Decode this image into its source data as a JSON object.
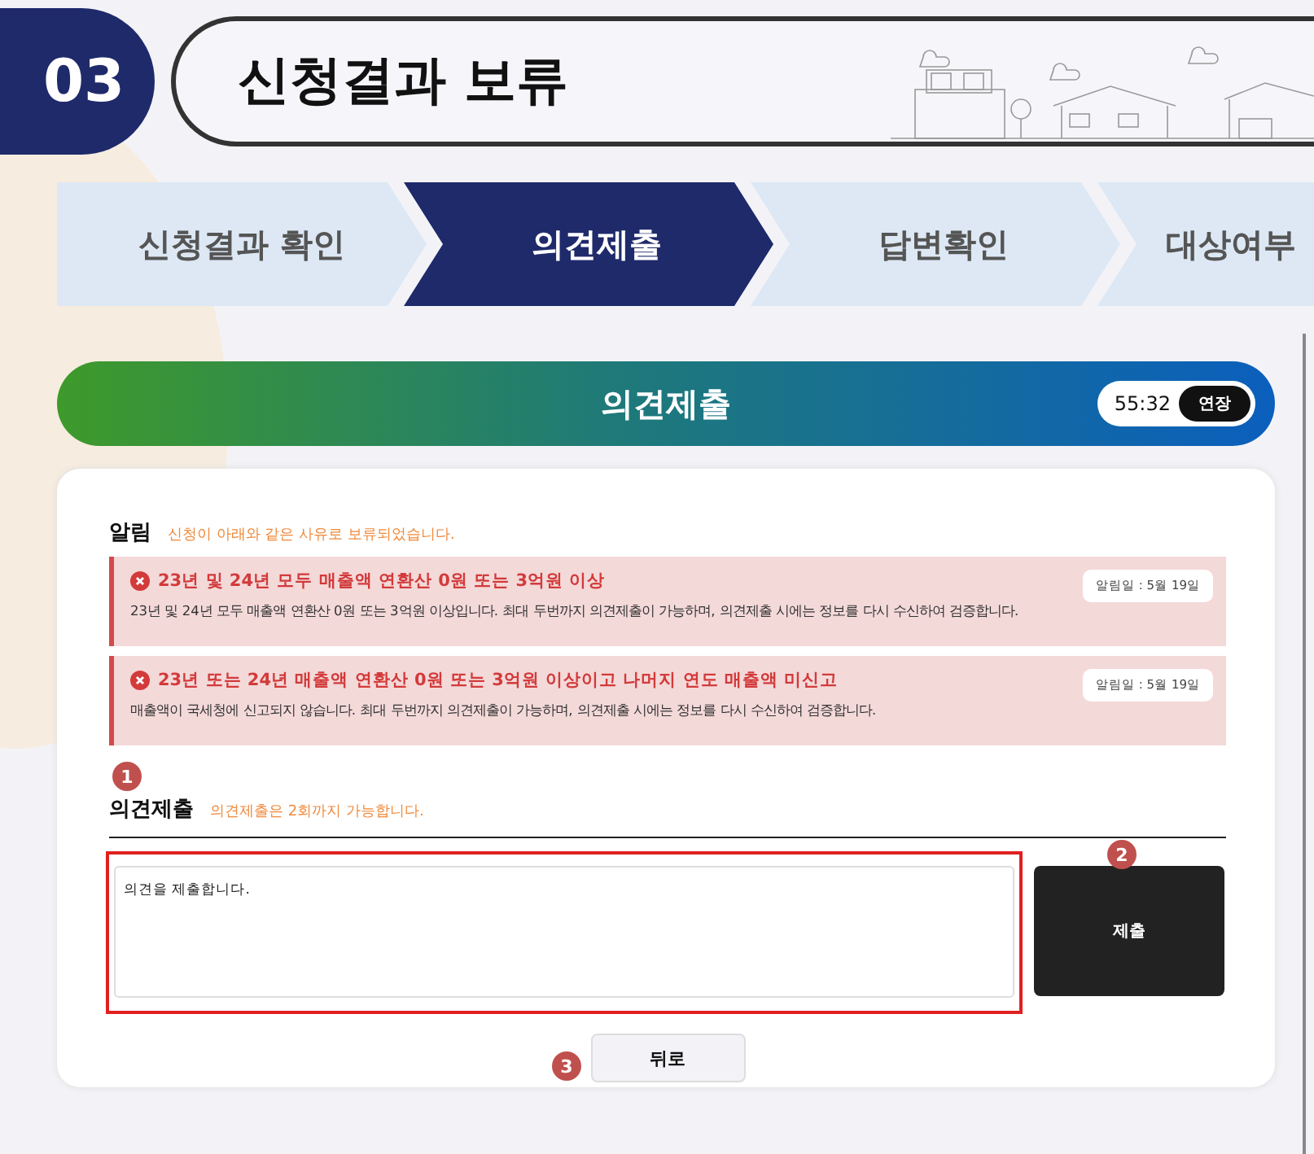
{
  "header": {
    "number": "03",
    "title": "신청결과 보류"
  },
  "steps": [
    {
      "label": "신청결과 확인",
      "selected": false
    },
    {
      "label": "의견제출",
      "selected": true
    },
    {
      "label": "답변확인",
      "selected": false
    },
    {
      "label": "대상여부",
      "selected": false
    }
  ],
  "section_bar": {
    "title": "의견제출",
    "timer": "55:32",
    "extend_button": "연장"
  },
  "notice": {
    "title": "알림",
    "subtitle": "신청이 아래와 같은 사유로 보류되었습니다.",
    "alerts": [
      {
        "title": "23년 및 24년 모두 매출액 연환산 0원 또는 3억원 이상",
        "body": "23년 및 24년 모두 매출액 연환산 0원 또는 3억원 이상입니다. 최대 두번까지 의견제출이 가능하며, 의견제출 시에는 정보를 다시 수신하여 검증합니다.",
        "date": "알림일 : 5월 19일"
      },
      {
        "title": "23년 또는 24년 매출액 연환산 0원 또는 3억원 이상이고 나머지 연도 매출액 미신고",
        "body": "매출액이 국세청에 신고되지 않습니다. 최대 두번까지 의견제출이 가능하며, 의견제출 시에는 정보를 다시 수신하여 검증합니다.",
        "date": "알림일 : 5월 19일"
      }
    ]
  },
  "opinion": {
    "marker": "1",
    "title": "의견제출",
    "hint": "의견제출은 2회까지 가능합니다.",
    "value": "의견을 제출합니다.",
    "submit_marker": "2",
    "submit_button": "제출",
    "back_marker": "3",
    "back_button": "뒤로"
  }
}
